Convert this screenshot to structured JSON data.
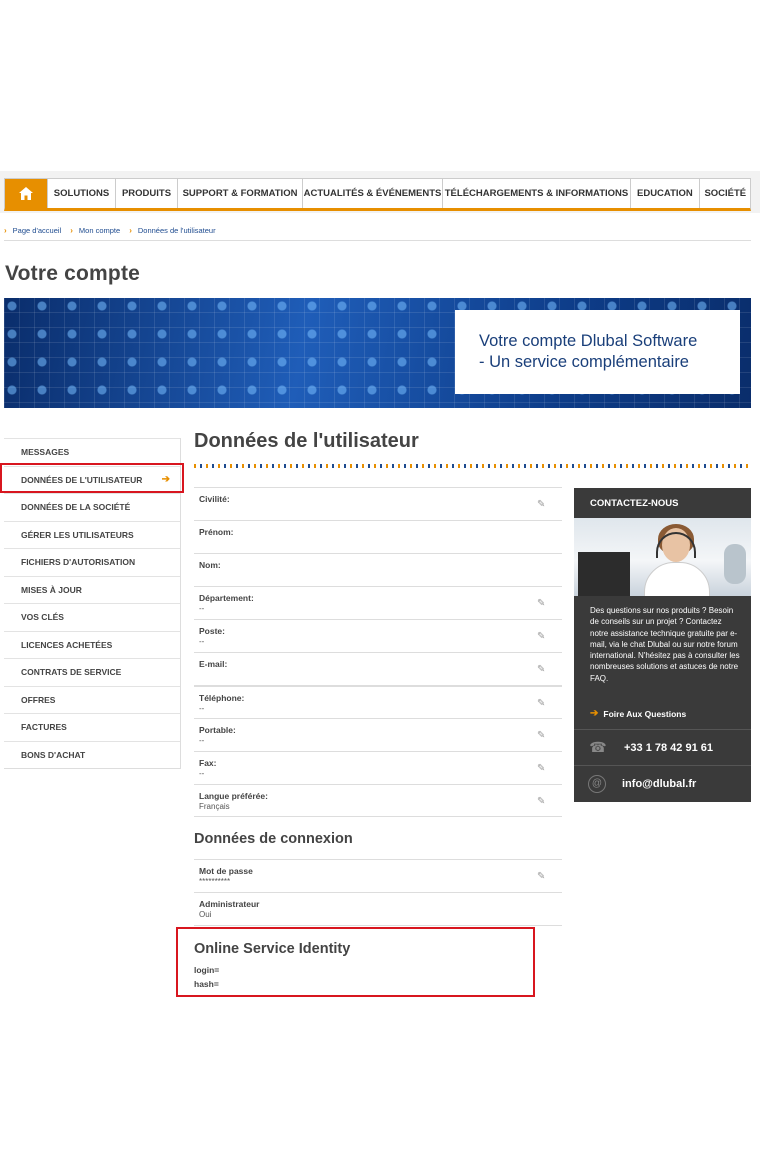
{
  "nav": {
    "home_icon": "home-icon",
    "items": [
      "SOLUTIONS",
      "PRODUITS",
      "SUPPORT & FORMATION",
      "ACTUALITÉS & ÉVÉNEMENTS",
      "TÉLÉCHARGEMENTS & INFORMATIONS",
      "EDUCATION",
      "SOCIÉTÉ"
    ]
  },
  "breadcrumb": [
    "Page d'accueil",
    "Mon compte",
    "Données de l'utilisateur"
  ],
  "page_title": "Votre compte",
  "banner": {
    "line1": "Votre compte Dlubal Software",
    "line2": "- Un service complémentaire"
  },
  "sidebar": {
    "items": [
      "MESSAGES",
      "DONNÉES DE L'UTILISATEUR",
      "DONNÉES DE LA SOCIÉTÉ",
      "GÉRER LES UTILISATEURS",
      "FICHIERS D'AUTORISATION",
      "MISES À JOUR",
      "VOS CLÉS",
      "LICENCES ACHETÉES",
      "CONTRATS DE SERVICE",
      "OFFRES",
      "FACTURES",
      "BONS D'ACHAT"
    ],
    "active": "DONNÉES DE L'UTILISATEUR"
  },
  "main": {
    "title": "Données de l'utilisateur",
    "fields": [
      {
        "label": "Civilité:",
        "value": ""
      },
      {
        "label": "Prénom:",
        "value": ""
      },
      {
        "label": "Nom:",
        "value": ""
      },
      {
        "label": "Département:",
        "value": "--"
      },
      {
        "label": "Poste:",
        "value": "--"
      },
      {
        "label": "E-mail:",
        "value": ""
      },
      {
        "label": "Téléphone:",
        "value": "--"
      },
      {
        "label": "Portable:",
        "value": "--"
      },
      {
        "label": "Fax:",
        "value": "--"
      },
      {
        "label": "Langue préférée:",
        "value": "Français"
      }
    ]
  },
  "login": {
    "title": "Données de connexion",
    "fields": [
      {
        "label": "Mot de passe",
        "value": "**********"
      },
      {
        "label": "Administrateur",
        "value": "Oui"
      }
    ]
  },
  "osi": {
    "title": "Online Service Identity",
    "login": "login=",
    "hash": "hash="
  },
  "contact": {
    "title": "CONTACTEZ-NOUS",
    "text": "Des questions sur nos produits ? Besoin de conseils sur un projet ? Contactez notre assistance technique gratuite par e-mail, via le chat Dlubal ou sur notre forum international. N'hésitez pas à consulter les nombreuses solutions et astuces de notre FAQ.",
    "faq": "Foire Aux Questions",
    "phone": "+33 1 78 42 91 61",
    "email": "info@dlubal.fr"
  },
  "colors": {
    "accent": "#e78f00",
    "brand_blue": "#1e4b8f",
    "highlight": "#d8161f",
    "panel": "#3a3a3a"
  }
}
